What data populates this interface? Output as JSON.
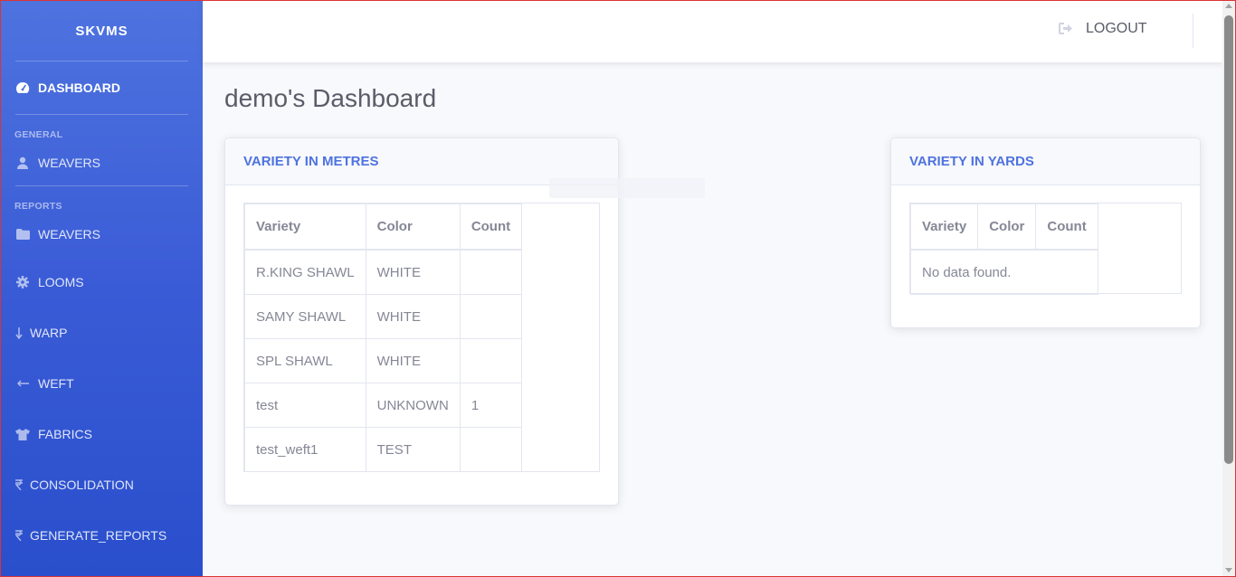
{
  "sidebar": {
    "brand": "SKVMS",
    "dashboard": "DASHBOARD",
    "general_heading": "GENERAL",
    "general_weavers": "WEAVERS",
    "reports_heading": "REPORTS",
    "items": [
      {
        "label": "WEAVERS",
        "icon": "folder-icon"
      },
      {
        "label": "LOOMS",
        "icon": "cog-icon"
      },
      {
        "label": "WARP",
        "icon": "arrow-down-icon"
      },
      {
        "label": "WEFT",
        "icon": "arrow-left-icon"
      },
      {
        "label": "FABRICS",
        "icon": "tshirt-icon"
      },
      {
        "label": "CONSOLIDATION",
        "icon": "rupee-icon"
      },
      {
        "label": "GENERATE_REPORTS",
        "icon": "rupee-icon"
      }
    ]
  },
  "topbar": {
    "logout": "LOGOUT"
  },
  "page": {
    "title": "demo's Dashboard"
  },
  "metres": {
    "title": "VARIETY IN METRES",
    "headers": [
      "Variety",
      "Color",
      "Count"
    ],
    "rows": [
      [
        "R.KING SHAWL",
        "WHITE",
        ""
      ],
      [
        "SAMY SHAWL",
        "WHITE",
        ""
      ],
      [
        "SPL SHAWL",
        "WHITE",
        ""
      ],
      [
        "test",
        "UNKNOWN",
        "1"
      ],
      [
        "test_weft1",
        "TEST",
        ""
      ]
    ]
  },
  "yards": {
    "title": "VARIETY IN YARDS",
    "headers": [
      "Variety",
      "Color",
      "Count"
    ],
    "empty": "No data found."
  },
  "colors": {
    "primary": "#4e73df",
    "text": "#858796",
    "title": "#5a5c69"
  }
}
